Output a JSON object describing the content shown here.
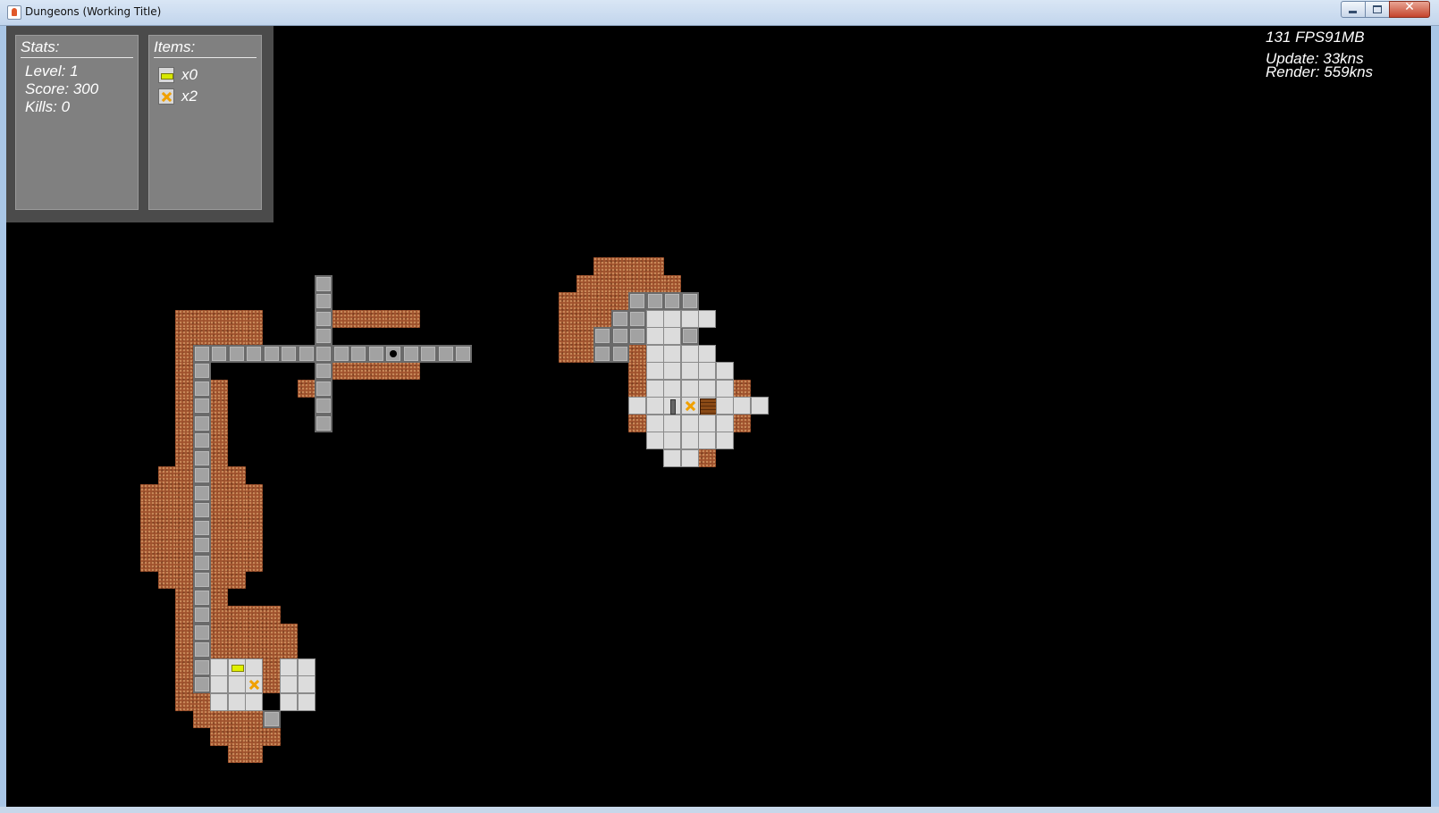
{
  "window": {
    "title": "Dungeons (Working Title)",
    "close_glyph": "✕"
  },
  "hud": {
    "stats": {
      "title": "Stats:",
      "level": "Level: 1",
      "score": "Score: 300",
      "kills": "Kills: 0"
    },
    "items": {
      "title": "Items:",
      "key_count": "x0",
      "cross_count": "x2"
    },
    "debug": {
      "fps": "131 FPS91MB",
      "update": "Update: 33kns",
      "render": "Render: 559kns"
    }
  },
  "icons": {
    "key": "key-icon",
    "cross": "cross-item-icon",
    "chest": "chest-icon",
    "lever": "lever-icon",
    "player": "player-marker"
  },
  "colors": {
    "dirt": "#a0522d",
    "path": "#a2a2a2",
    "floor": "#dcdcdc",
    "background": "#000000",
    "hud_panel": "#808080"
  },
  "map": {
    "dirt_rects": [
      [
        10,
        17,
        14,
        19
      ],
      [
        10,
        20,
        11,
        39
      ],
      [
        12,
        21,
        12,
        35
      ],
      [
        8,
        27,
        9,
        31
      ],
      [
        9,
        26,
        9,
        32
      ],
      [
        13,
        27,
        14,
        31
      ],
      [
        13,
        26,
        13,
        32
      ],
      [
        12,
        34,
        15,
        37
      ],
      [
        15,
        35,
        16,
        37
      ],
      [
        11,
        38,
        14,
        40
      ],
      [
        12,
        40,
        15,
        41
      ],
      [
        12,
        41,
        15,
        41
      ],
      [
        13,
        41,
        14,
        42
      ],
      [
        15,
        38,
        17,
        38
      ],
      [
        18,
        17,
        23,
        17
      ],
      [
        18,
        20,
        23,
        20
      ],
      [
        34,
        14,
        37,
        16
      ],
      [
        33,
        15,
        38,
        16
      ],
      [
        32,
        16,
        34,
        19
      ],
      [
        35,
        15,
        38,
        16
      ],
      [
        36,
        19,
        36,
        22
      ],
      [
        42,
        21,
        42,
        21
      ],
      [
        36,
        23,
        36,
        23
      ],
      [
        42,
        23,
        42,
        23
      ],
      [
        38,
        25,
        38,
        25
      ],
      [
        40,
        25,
        40,
        25
      ],
      [
        17,
        21,
        17,
        21
      ]
    ],
    "path_rects": [
      [
        18,
        15,
        18,
        23
      ],
      [
        11,
        19,
        26,
        19
      ],
      [
        11,
        20,
        11,
        38
      ],
      [
        15,
        40,
        15,
        40
      ],
      [
        36,
        16,
        38,
        16
      ],
      [
        35,
        17,
        36,
        17
      ],
      [
        34,
        18,
        35,
        19
      ],
      [
        36,
        18,
        36,
        18
      ],
      [
        39,
        16,
        39,
        16
      ],
      [
        39,
        18,
        39,
        18
      ],
      [
        38,
        22,
        38,
        22
      ]
    ],
    "floor_rects": [
      [
        37,
        17,
        39,
        17
      ],
      [
        37,
        18,
        38,
        18
      ],
      [
        37,
        19,
        40,
        19
      ],
      [
        37,
        20,
        41,
        20
      ],
      [
        37,
        21,
        41,
        21
      ],
      [
        36,
        22,
        43,
        22
      ],
      [
        37,
        23,
        41,
        23
      ],
      [
        37,
        24,
        41,
        24
      ],
      [
        38,
        25,
        39,
        25
      ],
      [
        39,
        25,
        39,
        25
      ],
      [
        12,
        37,
        14,
        39
      ],
      [
        16,
        37,
        17,
        39
      ],
      [
        40,
        17,
        40,
        17
      ]
    ],
    "items": [
      {
        "kind": "key",
        "col": 13,
        "row": 37
      },
      {
        "kind": "cross",
        "col": 14,
        "row": 38
      },
      {
        "kind": "cross",
        "col": 39,
        "row": 22
      },
      {
        "kind": "chest",
        "col": 40,
        "row": 22
      },
      {
        "kind": "lever",
        "col": 38,
        "row": 22
      }
    ],
    "player": {
      "col": 22,
      "row": 19
    }
  }
}
